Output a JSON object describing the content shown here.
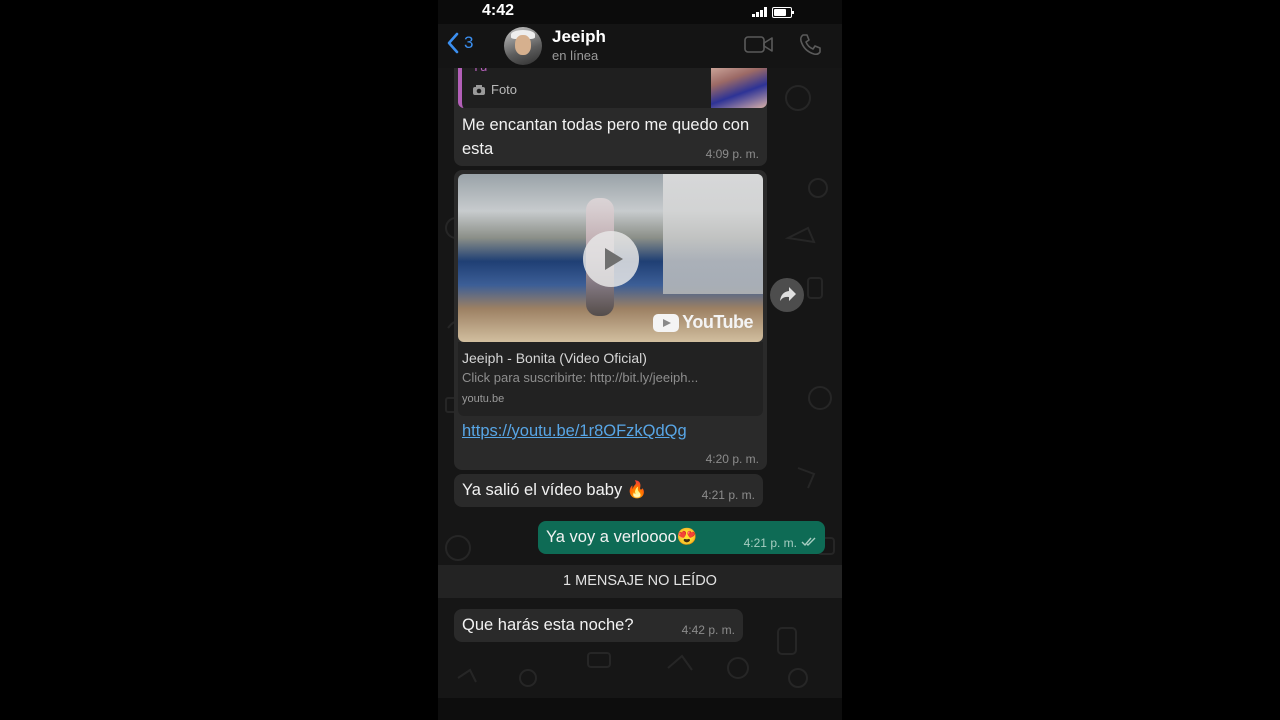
{
  "status_bar": {
    "time": "4:42"
  },
  "header": {
    "back_count": "3",
    "contact_name": "Jeeiph",
    "contact_status": "en línea",
    "icons": [
      "back-chevron-icon",
      "video-call-icon",
      "phone-call-icon"
    ]
  },
  "messages": {
    "m1": {
      "quoted_author": "Tú",
      "quoted_type": "Foto",
      "text": "Me encantan todas pero me quedo con esta",
      "time": "4:09 p. m."
    },
    "m2": {
      "link_title": "Jeeiph - Bonita (Video Oficial)",
      "link_desc": "Click para suscribirte: http://bit.ly/jeeiph...",
      "link_domain": "youtu.be",
      "video_brand": "YouTube",
      "url": "https://youtu.be/1r8OFzkQdQg",
      "time": "4:20 p. m."
    },
    "m3": {
      "text": "Ya salió el vídeo baby 🔥",
      "time": "4:21 p. m."
    },
    "m4": {
      "text": "Ya voy a verloooo😍",
      "time": "4:21 p. m."
    },
    "unread_banner": "1 MENSAJE NO LEÍDO",
    "m5": {
      "text": "Que harás esta noche?",
      "time": "4:42 p. m."
    }
  },
  "colors": {
    "incoming_bubble": "#2a2a2a",
    "outgoing_bubble": "#0e6b55",
    "accent_blue": "#3b8ff0",
    "quote_bar": "#b35fb8",
    "link": "#58a6e6"
  }
}
